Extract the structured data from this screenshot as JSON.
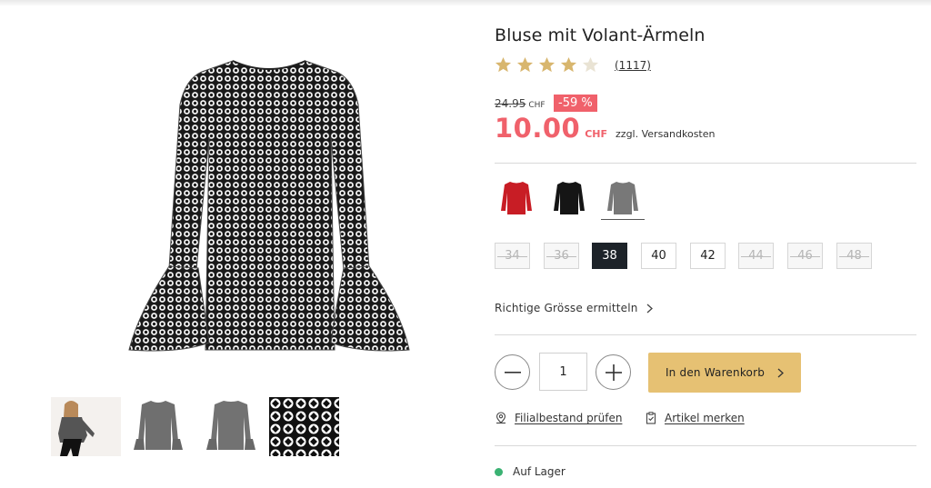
{
  "product": {
    "title": "Bluse mit Volant-Ärmeln",
    "rating_stars": 4,
    "rating_max": 5,
    "review_count": "(1117)",
    "old_price": "24.95",
    "old_currency": "CHF",
    "discount": "-59 %",
    "price": "10.00",
    "currency": "CHF",
    "shipping_note": "zzgl. Versandkosten",
    "price_color": "#f0616b"
  },
  "gallery": {
    "main_image": "blouse-front-photo",
    "thumbnails": [
      "model-photo",
      "blouse-front-photo",
      "blouse-back-photo",
      "fabric-pattern-closeup"
    ],
    "active_thumbnail": 1
  },
  "colors": {
    "options": [
      "red",
      "black",
      "grey"
    ],
    "selected": "grey"
  },
  "sizes": {
    "options": [
      {
        "label": "34",
        "available": false
      },
      {
        "label": "36",
        "available": false
      },
      {
        "label": "38",
        "available": true,
        "selected": true
      },
      {
        "label": "40",
        "available": true
      },
      {
        "label": "42",
        "available": true
      },
      {
        "label": "44",
        "available": false
      },
      {
        "label": "46",
        "available": false
      },
      {
        "label": "48",
        "available": false
      }
    ]
  },
  "size_guide_label": "Richtige Grösse ermitteln",
  "quantity": "1",
  "cart_button_label": "In den Warenkorb",
  "cart_button_color": "#e6c173",
  "store_stock_label": "Filialbestand prüfen",
  "wishlist_label": "Artikel merken",
  "stock_status": "Auf Lager",
  "stock_color": "#3bb273"
}
